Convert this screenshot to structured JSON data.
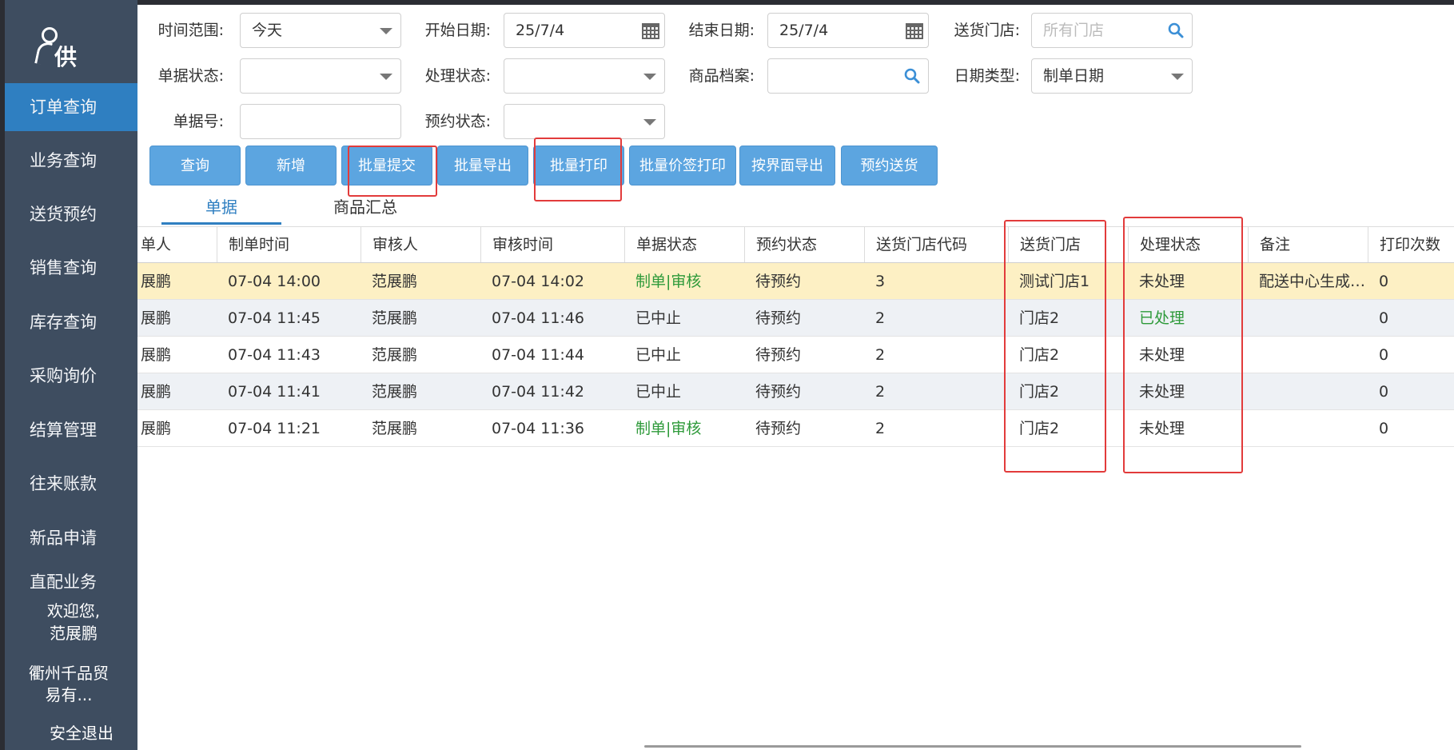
{
  "sidebar": {
    "logo_text": "供",
    "items": [
      {
        "label": "订单查询",
        "active": true
      },
      {
        "label": "业务查询"
      },
      {
        "label": "送货预约"
      },
      {
        "label": "销售查询"
      },
      {
        "label": "库存查询"
      },
      {
        "label": "采购询价"
      },
      {
        "label": "结算管理"
      },
      {
        "label": "往来账款"
      },
      {
        "label": "新品申请"
      },
      {
        "label": "直配业务"
      }
    ],
    "welcome_line1": "欢迎您,",
    "welcome_line2": "范展鹏",
    "company_line1": "衢州千品贸",
    "company_line2": "易有...",
    "logout": "安全退出"
  },
  "filters": {
    "time_range": {
      "label": "时间范围:",
      "value": "今天"
    },
    "start_date": {
      "label": "开始日期:",
      "value": "25/7/4"
    },
    "end_date": {
      "label": "结束日期:",
      "value": "25/7/4"
    },
    "store": {
      "label": "送货门店:",
      "placeholder": "所有门店"
    },
    "doc_status": {
      "label": "单据状态:",
      "value": ""
    },
    "process_status": {
      "label": "处理状态:",
      "value": ""
    },
    "product_file": {
      "label": "商品档案:",
      "value": ""
    },
    "date_type": {
      "label": "日期类型:",
      "value": "制单日期"
    },
    "doc_no": {
      "label": "单据号:",
      "value": ""
    },
    "reserve_status": {
      "label": "预约状态:",
      "value": ""
    }
  },
  "buttons": {
    "query": "查询",
    "add": "新增",
    "batch_submit": "批量提交",
    "batch_export": "批量导出",
    "batch_print": "批量打印",
    "batch_price_print": "批量价签打印",
    "export_by_view": "按界面导出",
    "reserve_delivery": "预约送货"
  },
  "tabs": [
    "单据",
    "商品汇总"
  ],
  "table": {
    "headers": [
      "单人",
      "制单时间",
      "审核人",
      "审核时间",
      "单据状态",
      "预约状态",
      "送货门店代码",
      "送货门店",
      "处理状态",
      "备注",
      "打印次数"
    ],
    "rows": [
      [
        "展鹏",
        "07-04 14:00",
        "范展鹏",
        "07-04 14:02",
        "制单|审核",
        "待预约",
        "3",
        "测试门店1",
        "未处理",
        "配送中心生成…",
        "0"
      ],
      [
        "展鹏",
        "07-04 11:45",
        "范展鹏",
        "07-04 11:46",
        "已中止",
        "待预约",
        "2",
        "门店2",
        "已处理",
        "",
        "0"
      ],
      [
        "展鹏",
        "07-04 11:43",
        "范展鹏",
        "07-04 11:44",
        "已中止",
        "待预约",
        "2",
        "门店2",
        "未处理",
        "",
        "0"
      ],
      [
        "展鹏",
        "07-04 11:41",
        "范展鹏",
        "07-04 11:42",
        "已中止",
        "待预约",
        "2",
        "门店2",
        "未处理",
        "",
        "0"
      ],
      [
        "展鹏",
        "07-04 11:21",
        "范展鹏",
        "07-04 11:36",
        "制单|审核",
        "待预约",
        "2",
        "门店2",
        "未处理",
        "",
        "0"
      ]
    ]
  },
  "colors": {
    "sidebar_bg": "#3e4d60",
    "active_nav": "#2f7fc1",
    "button_bg": "#5ca5e0",
    "highlight_border": "#e23b3b",
    "selected_row": "#fdf0c4",
    "alt_row": "#eef1f5",
    "status_green": "#2e9a3a"
  }
}
